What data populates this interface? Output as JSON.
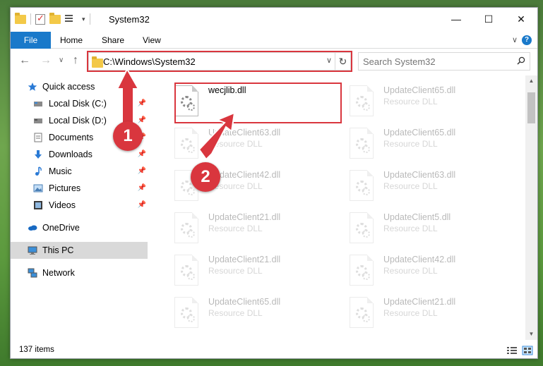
{
  "window": {
    "title": "System32"
  },
  "ribbon": {
    "tabs": [
      {
        "label": "File"
      },
      {
        "label": "Home"
      },
      {
        "label": "Share"
      },
      {
        "label": "View"
      }
    ]
  },
  "address": {
    "path": "C:\\Windows\\System32"
  },
  "search": {
    "placeholder": "Search System32"
  },
  "sidebar": {
    "items": [
      {
        "label": "Quick access",
        "icon": "star-icon"
      },
      {
        "label": "Local Disk (C:)",
        "icon": "drive-icon",
        "pinned": true
      },
      {
        "label": "Local Disk (D:)",
        "icon": "drive-icon",
        "pinned": true
      },
      {
        "label": "Documents",
        "icon": "documents-icon",
        "pinned": true
      },
      {
        "label": "Downloads",
        "icon": "download-icon",
        "pinned": true
      },
      {
        "label": "Music",
        "icon": "music-icon",
        "pinned": true
      },
      {
        "label": "Pictures",
        "icon": "pictures-icon",
        "pinned": true
      },
      {
        "label": "Videos",
        "icon": "videos-icon",
        "pinned": true
      },
      {
        "label": "OneDrive",
        "icon": "cloud-icon"
      },
      {
        "label": "This PC",
        "icon": "computer-icon",
        "selected": true
      },
      {
        "label": "Network",
        "icon": "network-icon"
      }
    ]
  },
  "files": [
    {
      "name": "wecjlib.dll",
      "type": "",
      "highlighted": true
    },
    {
      "name": "UpdateClient65.dll",
      "type": "Resource DLL"
    },
    {
      "name": "UpdateClient63.dll",
      "type": "Resource DLL"
    },
    {
      "name": "UpdateClient65.dll",
      "type": "Resource DLL"
    },
    {
      "name": "UpdateClient42.dll",
      "type": "Resource DLL"
    },
    {
      "name": "UpdateClient63.dll",
      "type": "Resource DLL"
    },
    {
      "name": "UpdateClient21.dll",
      "type": "Resource DLL"
    },
    {
      "name": "UpdateClient5.dll",
      "type": "Resource DLL"
    },
    {
      "name": "UpdateClient21.dll",
      "type": "Resource DLL"
    },
    {
      "name": "UpdateClient42.dll",
      "type": "Resource DLL"
    },
    {
      "name": "UpdateClient65.dll",
      "type": "Resource DLL"
    },
    {
      "name": "UpdateClient21.dll",
      "type": "Resource DLL"
    }
  ],
  "status": {
    "item_count": "137 items"
  },
  "callouts": {
    "one": "1",
    "two": "2"
  },
  "colors": {
    "accent": "#1979ca",
    "highlight": "#d9363e",
    "selection": "#cce8ff"
  }
}
